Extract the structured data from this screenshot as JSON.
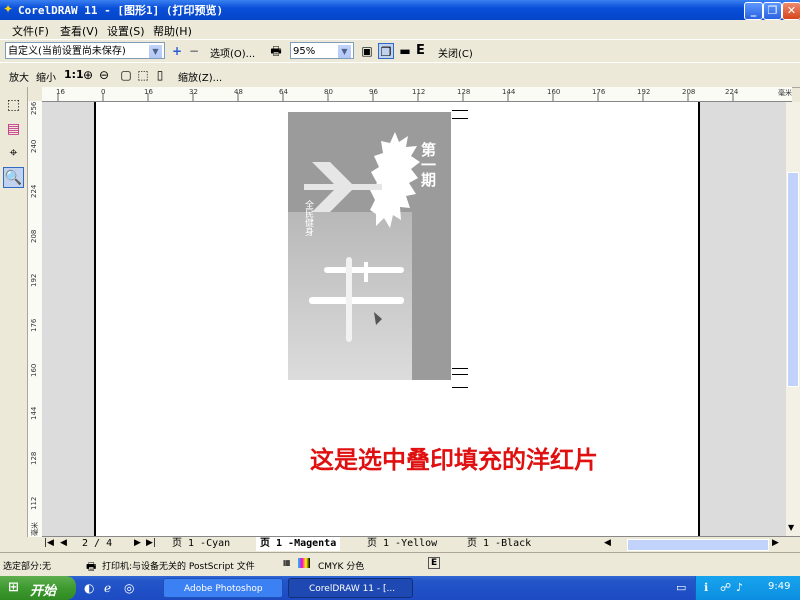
{
  "window": {
    "title": "CorelDRAW 11 - [图形1] (打印预览)",
    "minimize": "_",
    "restore": "❐",
    "close": "✕"
  },
  "menu": [
    "文件(F)",
    "查看(V)",
    "设置(S)",
    "帮助(H)"
  ],
  "toolbar1": {
    "style_value": "自定义(当前设置尚未保存)",
    "options_label": "选项(O)...",
    "zoom_value": "95%",
    "close_label": "关闭(C)",
    "e_label": "E"
  },
  "toolbar2": {
    "zoom_in": "放大",
    "zoom_out": "缩小",
    "one_to_one": "1:1",
    "scale_label": "缩放(Z)..."
  },
  "hruler_ticks": [
    "16",
    "0",
    "16",
    "32",
    "48",
    "64",
    "80",
    "96",
    "112",
    "128",
    "144",
    "160",
    "176",
    "192",
    "208",
    "224"
  ],
  "hruler_unit": "毫米",
  "vruler_ticks": [
    "256",
    "240",
    "224",
    "208",
    "192",
    "176",
    "160",
    "144",
    "128",
    "112"
  ],
  "vruler_unit": "毫米",
  "page_art": {
    "vertical_text": "第一期",
    "small_text": "全民健身"
  },
  "annotation": {
    "text": "这是选中叠印填充的洋红片",
    "color": "#e01010"
  },
  "pager": {
    "value": "2 / 4",
    "tabs": [
      "页 1 -Cyan",
      "页 1 -Magenta",
      "页 1 -Yellow",
      "页 1 -Black"
    ],
    "active_index": 1
  },
  "status": {
    "selection": "选定部分:无",
    "printer": "打印机:与设备无关的 PostScript 文件",
    "separation": "CMYK 分色",
    "e": "E"
  },
  "taskbar": {
    "start": "开始",
    "tasks": [
      "Adobe Photoshop",
      "CorelDRAW 11 - [..."
    ],
    "clock": "9:49"
  }
}
